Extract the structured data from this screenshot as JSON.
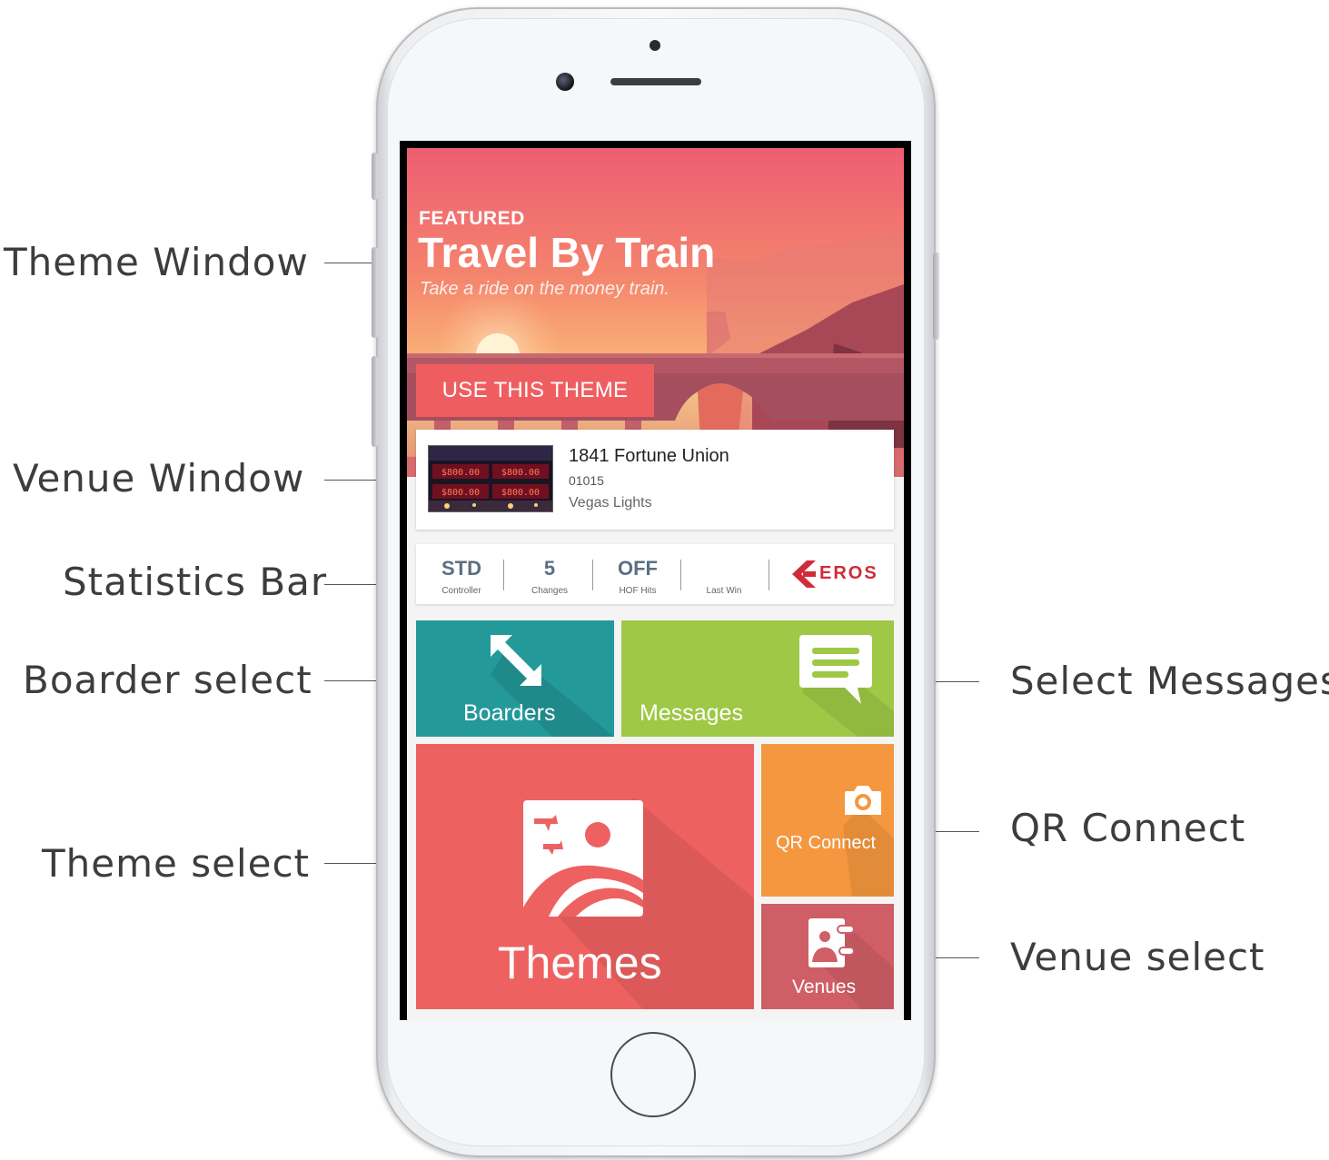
{
  "annotations": {
    "theme_window": "Theme Window",
    "venue_window": "Venue Window",
    "statistics_bar": "Statistics Bar",
    "boarder_select": "Boarder select",
    "theme_select": "Theme select",
    "select_messages": "Select Messages",
    "qr_connect": "QR Connect",
    "venue_select": "Venue select"
  },
  "hero": {
    "eyebrow": "FEATURED",
    "title": "Travel By Train",
    "subtitle": "Take a ride on the money train.",
    "cta_label": "USE THIS THEME"
  },
  "venue": {
    "name": "1841 Fortune Union",
    "code": "01015",
    "theme": "Vegas Lights",
    "thumb_values": [
      "$800.00",
      "$800.00",
      "$800.00",
      "$800.00"
    ]
  },
  "stats": [
    {
      "value": "STD",
      "label": "Controller"
    },
    {
      "value": "5",
      "label": "Changes"
    },
    {
      "value": "OFF",
      "label": "HOF Hits"
    },
    {
      "value": "",
      "label": "Last Win"
    }
  ],
  "brand": {
    "name": "EROS"
  },
  "tiles": {
    "boarders": "Boarders",
    "messages": "Messages",
    "themes": "Themes",
    "qr": "QR Connect",
    "venues": "Venues"
  },
  "colors": {
    "boarders": "#24999a",
    "messages": "#9ec845",
    "themes": "#ee6161",
    "qr": "#f4973f",
    "venues": "#cf5e67",
    "cta": "#ee5e60",
    "stat_value": "#5b6f83",
    "brand": "#cf2c39"
  },
  "icons": {
    "boarders": "resize-arrows-icon",
    "messages": "chat-bubble-icon",
    "themes": "landscape-image-icon",
    "qr": "camera-icon",
    "venues": "contact-card-icon"
  }
}
